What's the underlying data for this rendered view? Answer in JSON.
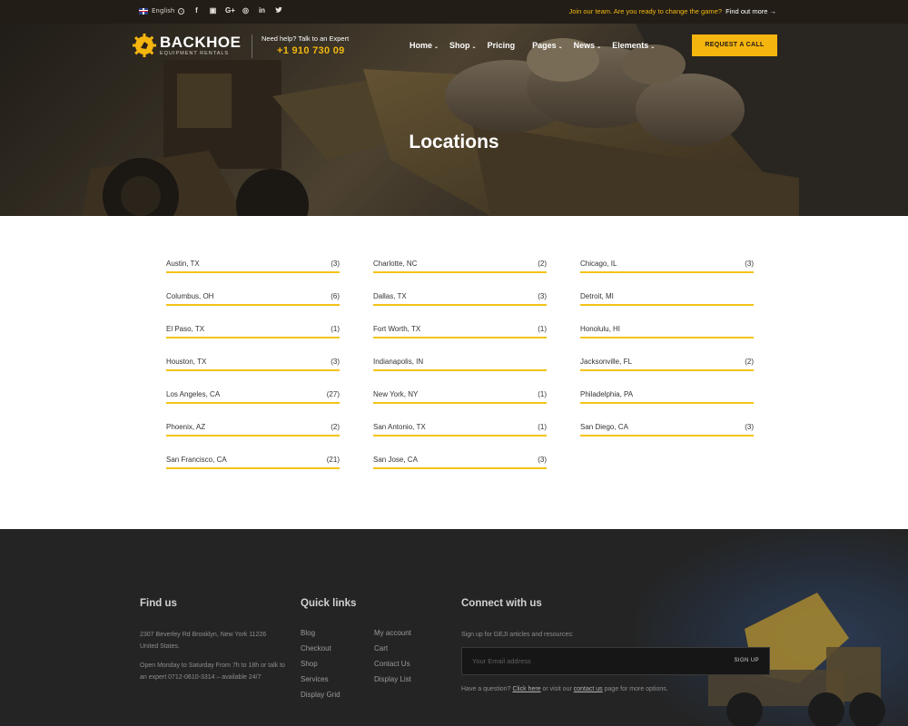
{
  "topbar": {
    "language": "English",
    "socials": [
      "f",
      "▣",
      "G+",
      "◎",
      "in",
      "🐦"
    ],
    "promo_text": "Join our team. Are you ready to change the game?",
    "promo_link": "Find out more →"
  },
  "header": {
    "logo_name": "BACKHOE",
    "logo_tagline": "EQUIPMENT RENTALS",
    "help_text": "Need help? Talk to an Expert",
    "phone": "+1 910 730 09",
    "nav": [
      {
        "label": "Home",
        "caret": "⌄"
      },
      {
        "label": "Shop",
        "caret": "⌄"
      },
      {
        "label": "Pricing",
        "caret": ""
      },
      {
        "label": "Pages",
        "caret": "⌄"
      },
      {
        "label": "News",
        "caret": "⌄"
      },
      {
        "label": "Elements",
        "caret": "⌄"
      }
    ],
    "cta_label": "REQUEST A CALL"
  },
  "hero": {
    "title": "Locations"
  },
  "locations": {
    "columns": [
      [
        {
          "name": "Austin, TX",
          "count": "(3)"
        },
        {
          "name": "Columbus, OH",
          "count": "(6)"
        },
        {
          "name": "El Paso, TX",
          "count": "(1)"
        },
        {
          "name": "Houston, TX",
          "count": "(3)"
        },
        {
          "name": "Los Angeles, CA",
          "count": "(27)"
        },
        {
          "name": "Phoenix, AZ",
          "count": "(2)"
        },
        {
          "name": "San Francisco, CA",
          "count": "(21)"
        }
      ],
      [
        {
          "name": "Charlotte, NC",
          "count": "(2)"
        },
        {
          "name": "Dallas, TX",
          "count": "(3)"
        },
        {
          "name": "Fort Worth, TX",
          "count": "(1)"
        },
        {
          "name": "Indianapolis, IN",
          "count": ""
        },
        {
          "name": "New York, NY",
          "count": "(1)"
        },
        {
          "name": "San Antonio, TX",
          "count": "(1)"
        },
        {
          "name": "San Jose, CA",
          "count": "(3)"
        }
      ],
      [
        {
          "name": "Chicago, IL",
          "count": "(3)"
        },
        {
          "name": "Detroit, MI",
          "count": ""
        },
        {
          "name": "Honolulu, HI",
          "count": ""
        },
        {
          "name": "Jacksonville, FL",
          "count": "(2)"
        },
        {
          "name": "Philadelphia, PA",
          "count": ""
        },
        {
          "name": "San Diego, CA",
          "count": "(3)"
        }
      ]
    ]
  },
  "footer": {
    "find_us": {
      "title": "Find us",
      "address": "2307 Beverley Rd Brooklyn, New York 11226 United States.",
      "hours": "Open Monday to Saturday From 7h to 18h or talk to an expert 0712-0610-3314 – available 24/7"
    },
    "quick_links": {
      "title": "Quick links",
      "col1": [
        "Blog",
        "Checkout",
        "Shop",
        "Services",
        "Display Grid"
      ],
      "col2": [
        "My account",
        "Cart",
        "Contact Us",
        "Display List"
      ]
    },
    "connect": {
      "title": "Connect with us",
      "signup_text": "Sign up for GEJI articles and resources:",
      "email_placeholder": "Your Email address",
      "signup_button": "SIGN UP",
      "question_pre": "Have a question?",
      "click_here": "Click here",
      "question_mid": "or visit our",
      "contact_us": "contact us",
      "question_post": "page for more options."
    }
  },
  "colors": {
    "accent": "#f5b50f",
    "topbar_bg": "#221d17",
    "footer_bg": "#242424"
  }
}
